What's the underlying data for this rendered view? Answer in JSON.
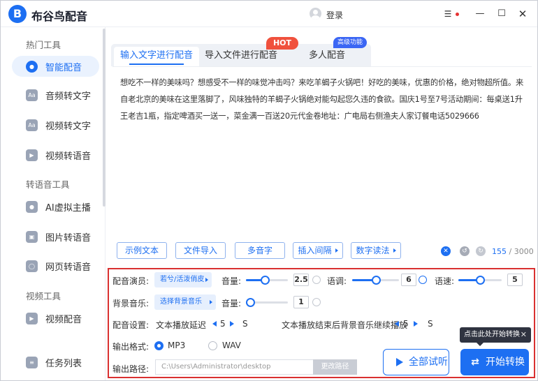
{
  "titlebar": {
    "app_title": "布谷鸟配音",
    "login": "登录",
    "icons": [
      "logo-icon",
      "layers-icon",
      "minimize-icon",
      "maximize-icon",
      "close-icon"
    ]
  },
  "sidebar": {
    "sections": [
      {
        "title": "热门工具"
      },
      {
        "title": "转语音工具"
      },
      {
        "title": "视频工具"
      }
    ],
    "items": [
      {
        "label": "智能配音",
        "active": true
      },
      {
        "label": "音频转文字"
      },
      {
        "label": "视频转文字"
      },
      {
        "label": "视频转语音"
      },
      {
        "label": "AI虚拟主播"
      },
      {
        "label": "图片转语音"
      },
      {
        "label": "网页转语音"
      },
      {
        "label": "视频配音"
      },
      {
        "label": "任务列表"
      }
    ]
  },
  "tabs": [
    {
      "label": "输入文字进行配音",
      "active": true
    },
    {
      "label": "导入文件进行配音",
      "badge": "HOT"
    },
    {
      "label": "多人配音",
      "badge": "高级功能"
    }
  ],
  "editor": {
    "text": "想吃不一样的美味吗？想感受不一样的味觉冲击吗？来吃羊蝎子火锅吧！好吃的美味，优惠的价格，绝对物超所值。来自老北京的美味在这里落脚了，风味独特的羊蝎子火锅绝对能勾起您久违的食欲。国庆1号至7号活动期间：每桌送1升王老吉1瓶，指定啤酒买一送一，菜金满一百送20元代金卷地址：广电局右侧渔夫人家订餐电话5029666",
    "char_count": "155",
    "char_limit": "/ 3000"
  },
  "toolbar": {
    "example_text": "示例文本",
    "import_file": "文件导入",
    "polyphone": "多音字",
    "insert_pause": "插入间隔",
    "number_reading": "数字读法"
  },
  "settings": {
    "voice_actor_label": "配音演员:",
    "voice_actor_value": "若兮/活泼俏皮",
    "volume_label": "音量:",
    "volume_value": "2.5",
    "volume_level": 0.45,
    "pitch_label": "语调:",
    "pitch_value": "6",
    "pitch_level": 0.5,
    "speed_label": "语速:",
    "speed_value": "5",
    "speed_level": 0.5,
    "bgm_label": "背景音乐:",
    "bgm_value": "选择背景音乐",
    "bgm_volume_label": "音量:",
    "bgm_volume_value": "1",
    "bgm_volume_level": 0.1,
    "setup_label": "配音设置:",
    "text_delay_label": "文本播放延迟",
    "text_delay_value": "5",
    "text_delay_unit": "S",
    "bgm_continue_label": "文本播放结束后背景音乐继续播放",
    "bgm_continue_value": "5",
    "bgm_continue_unit": "S",
    "format_label": "输出格式:",
    "format_mp3": "MP3",
    "format_wav": "WAV",
    "format_selected": "MP3",
    "path_label": "输出路径:",
    "path_value": "C:\\Users\\Administrator\\desktop",
    "change_path": "更改路径"
  },
  "actions": {
    "preview_all": "全部试听",
    "start_convert": "开始转换",
    "tooltip": "点击此处开始转换"
  },
  "colors": {
    "accent": "#1d6ff2",
    "hot_badge": "#f0513d",
    "adv_badge": "#3b66f4",
    "highlight_border": "#d93030"
  }
}
